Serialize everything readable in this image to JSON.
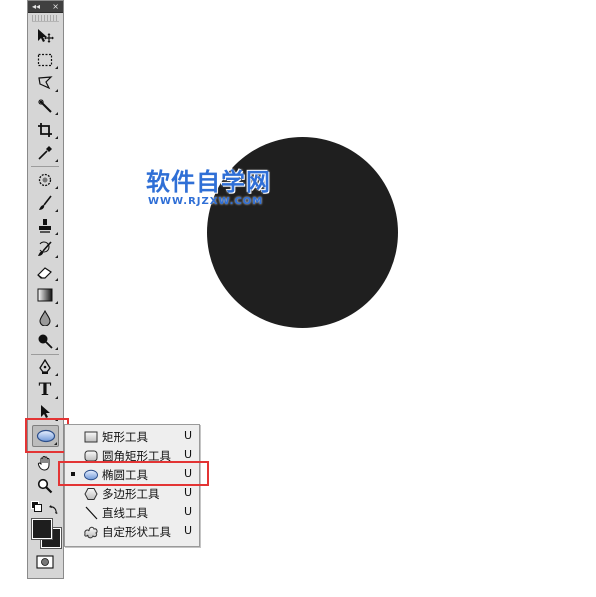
{
  "toolbar": {
    "header_collapse_glyph": "◂◂",
    "header_close_glyph": "×",
    "tools": [
      {
        "name": "move-tool",
        "icon": "move-icon"
      },
      {
        "name": "marquee-tool",
        "icon": "rect-marquee-icon"
      },
      {
        "name": "lasso-tool",
        "icon": "polygon-lasso-icon"
      },
      {
        "name": "magic-wand-tool",
        "icon": "magic-wand-icon"
      },
      {
        "name": "crop-tool",
        "icon": "crop-icon"
      },
      {
        "name": "eyedropper-tool",
        "icon": "eyedropper-icon"
      },
      {
        "name": "healing-brush-tool",
        "icon": "healing-icon"
      },
      {
        "name": "brush-tool",
        "icon": "brush-icon"
      },
      {
        "name": "clone-stamp-tool",
        "icon": "stamp-icon"
      },
      {
        "name": "history-brush-tool",
        "icon": "history-brush-icon"
      },
      {
        "name": "eraser-tool",
        "icon": "eraser-icon"
      },
      {
        "name": "gradient-tool",
        "icon": "gradient-icon"
      },
      {
        "name": "blur-tool",
        "icon": "drop-icon"
      },
      {
        "name": "dodge-tool",
        "icon": "dodge-icon"
      },
      {
        "name": "pen-tool",
        "icon": "pen-icon"
      },
      {
        "name": "type-tool",
        "icon": "type-icon"
      },
      {
        "name": "path-selection-tool",
        "icon": "arrow-icon"
      },
      {
        "name": "ellipse-tool",
        "icon": "ellipse-icon",
        "active": true
      },
      {
        "name": "hand-tool",
        "icon": "hand-icon"
      },
      {
        "name": "zoom-tool",
        "icon": "zoom-icon"
      }
    ],
    "type_glyph": "T",
    "foreground_color": "#1e1e1e",
    "background_color": "#1e1e1e"
  },
  "canvas": {
    "circle_color": "#1f1f1f"
  },
  "watermark": {
    "title": "软件自学网",
    "url": "WWW.RJZXW.COM",
    "color": "#2f6fd6"
  },
  "flyout": {
    "items": [
      {
        "label": "矩形工具",
        "shortcut": "U",
        "icon": "rectangle-icon",
        "selected": false
      },
      {
        "label": "圆角矩形工具",
        "shortcut": "U",
        "icon": "rounded-rectangle-icon",
        "selected": false
      },
      {
        "label": "椭圆工具",
        "shortcut": "U",
        "icon": "ellipse-icon",
        "selected": true
      },
      {
        "label": "多边形工具",
        "shortcut": "U",
        "icon": "polygon-icon",
        "selected": false
      },
      {
        "label": "直线工具",
        "shortcut": "U",
        "icon": "line-icon",
        "selected": false
      },
      {
        "label": "自定形状工具",
        "shortcut": "U",
        "icon": "custom-shape-icon",
        "selected": false
      }
    ]
  },
  "highlight_color": "#e33434"
}
